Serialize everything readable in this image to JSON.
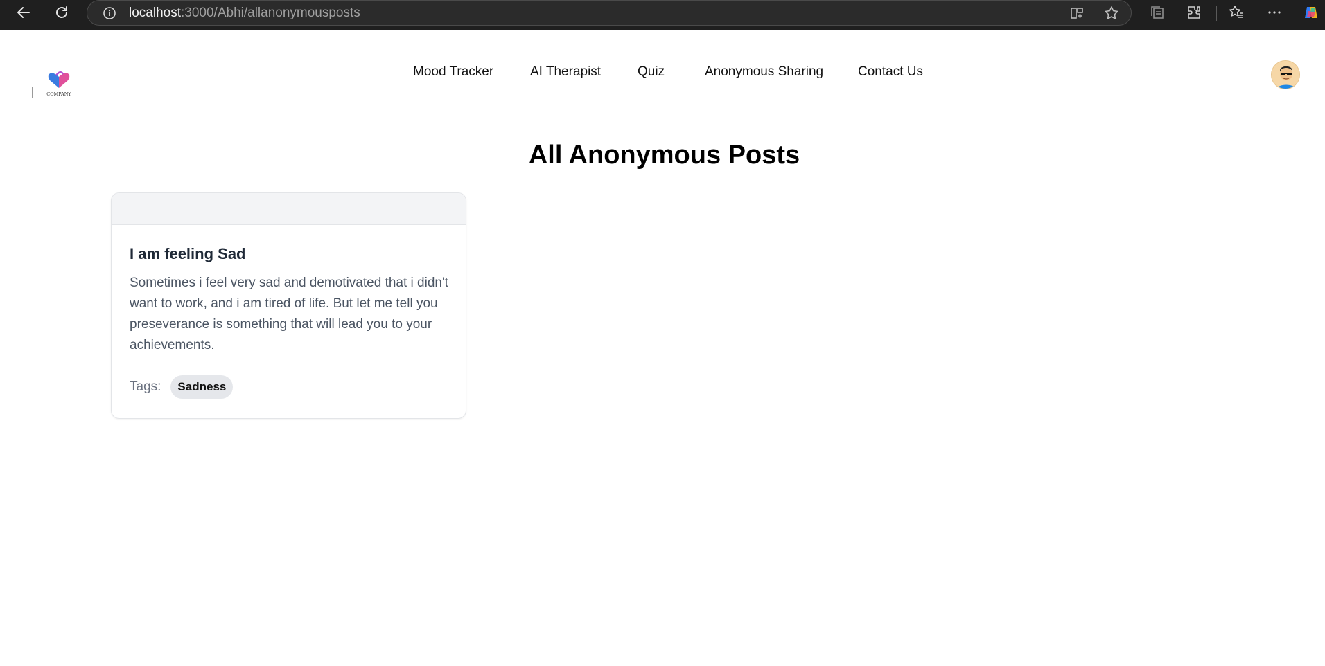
{
  "browser": {
    "url_host": "localhost",
    "url_path": ":3000/Abhi/allanonymousposts",
    "icons": [
      "back-arrow-icon",
      "refresh-icon",
      "info-icon",
      "split-screen-icon",
      "favorite-star-icon",
      "collections-icon",
      "extensions-icon",
      "favorites-icon",
      "more-icon",
      "copilot-icon"
    ]
  },
  "header": {
    "logo_text": "COMPANY",
    "nav": [
      "Mood Tracker",
      "AI Therapist",
      "Quiz",
      "Anonymous Sharing",
      "Contact Us"
    ]
  },
  "main": {
    "title": "All Anonymous Posts",
    "posts": [
      {
        "title": "I am feeling Sad",
        "body": "Sometimes i feel very sad and demotivated that i didn't want to work, and i am tired of life. But let me tell you preseverance is something that will lead you to your achievements.",
        "tags_label": "Tags:",
        "tags": [
          "Sadness"
        ]
      }
    ]
  },
  "colors": {
    "chrome_bg": "#1f1f1f",
    "page_bg": "#ffffff",
    "card_border": "#e3e5e8",
    "tag_bg": "#e5e7eb"
  }
}
